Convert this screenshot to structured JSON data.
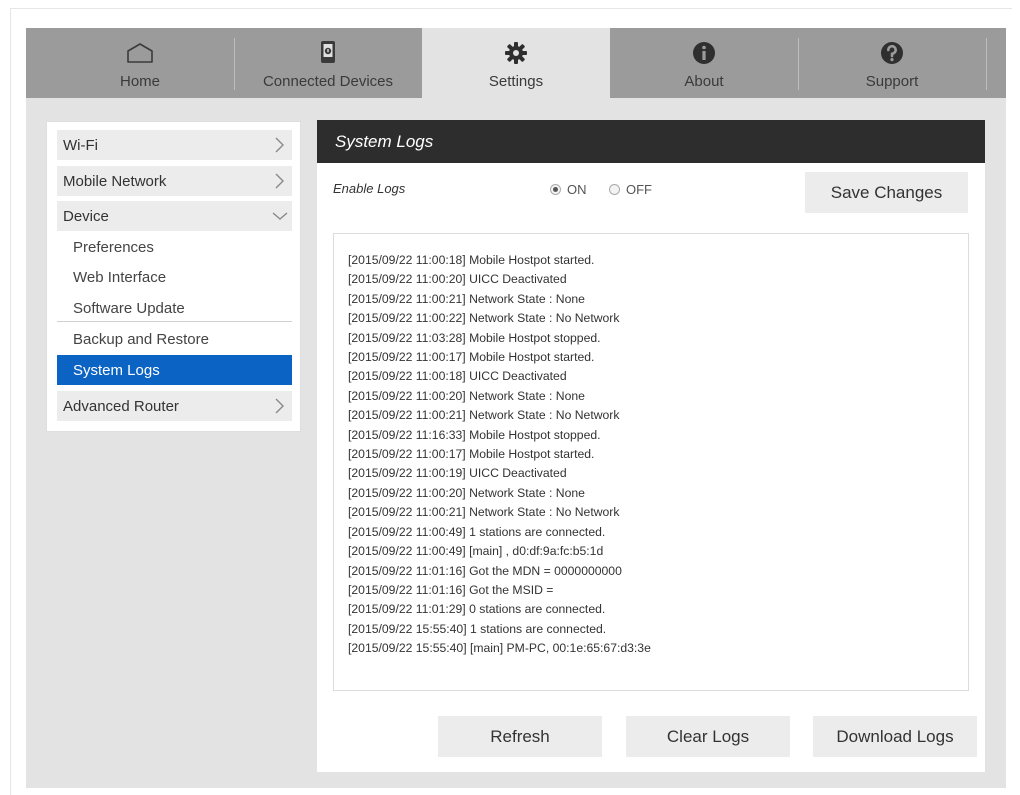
{
  "nav": {
    "tabs": [
      {
        "label": "Home",
        "icon": "home-icon"
      },
      {
        "label": "Connected Devices",
        "icon": "connected-devices-icon"
      },
      {
        "label": "Settings",
        "icon": "gear-icon"
      },
      {
        "label": "About",
        "icon": "info-icon"
      },
      {
        "label": "Support",
        "icon": "help-icon"
      }
    ],
    "active": "Settings"
  },
  "sidebar": {
    "items": [
      {
        "label": "Wi-Fi"
      },
      {
        "label": "Mobile Network"
      },
      {
        "label": "Device"
      },
      {
        "label": "Advanced Router"
      }
    ],
    "device_subitems": [
      {
        "label": "Preferences"
      },
      {
        "label": "Web Interface"
      },
      {
        "label": "Software Update"
      },
      {
        "label": "Backup and Restore"
      },
      {
        "label": "System Logs"
      }
    ],
    "active": "System Logs"
  },
  "panel": {
    "title": "System Logs",
    "enable_label": "Enable Logs",
    "radio_on": "ON",
    "radio_off": "OFF",
    "enabled": "ON",
    "save_button": "Save Changes",
    "refresh_button": "Refresh",
    "clear_button": "Clear Logs",
    "download_button": "Download Logs"
  },
  "logs": [
    "[2015/09/22 11:00:18] Mobile Hostpot started.",
    "[2015/09/22 11:00:20] UICC Deactivated",
    "[2015/09/22 11:00:21] Network State : None",
    "[2015/09/22 11:00:22] Network State : No Network",
    "[2015/09/22 11:03:28] Mobile Hostpot stopped.",
    "[2015/09/22 11:00:17] Mobile Hostpot started.",
    "[2015/09/22 11:00:18] UICC Deactivated",
    "[2015/09/22 11:00:20] Network State : None",
    "[2015/09/22 11:00:21] Network State : No Network",
    "[2015/09/22 11:16:33] Mobile Hostpot stopped.",
    "[2015/09/22 11:00:17] Mobile Hostpot started.",
    "[2015/09/22 11:00:19] UICC Deactivated",
    "[2015/09/22 11:00:20] Network State : None",
    "[2015/09/22 11:00:21] Network State : No Network",
    "[2015/09/22 11:00:49] 1 stations are connected.",
    "[2015/09/22 11:00:49] [main] , d0:df:9a:fc:b5:1d",
    "[2015/09/22 11:01:16] Got the MDN = 0000000000",
    "[2015/09/22 11:01:16] Got the MSID =",
    "[2015/09/22 11:01:29] 0 stations are connected.",
    "[2015/09/22 15:55:40] 1 stations are connected.",
    "[2015/09/22 15:55:40] [main] PM-PC, 00:1e:65:67:d3:3e"
  ]
}
